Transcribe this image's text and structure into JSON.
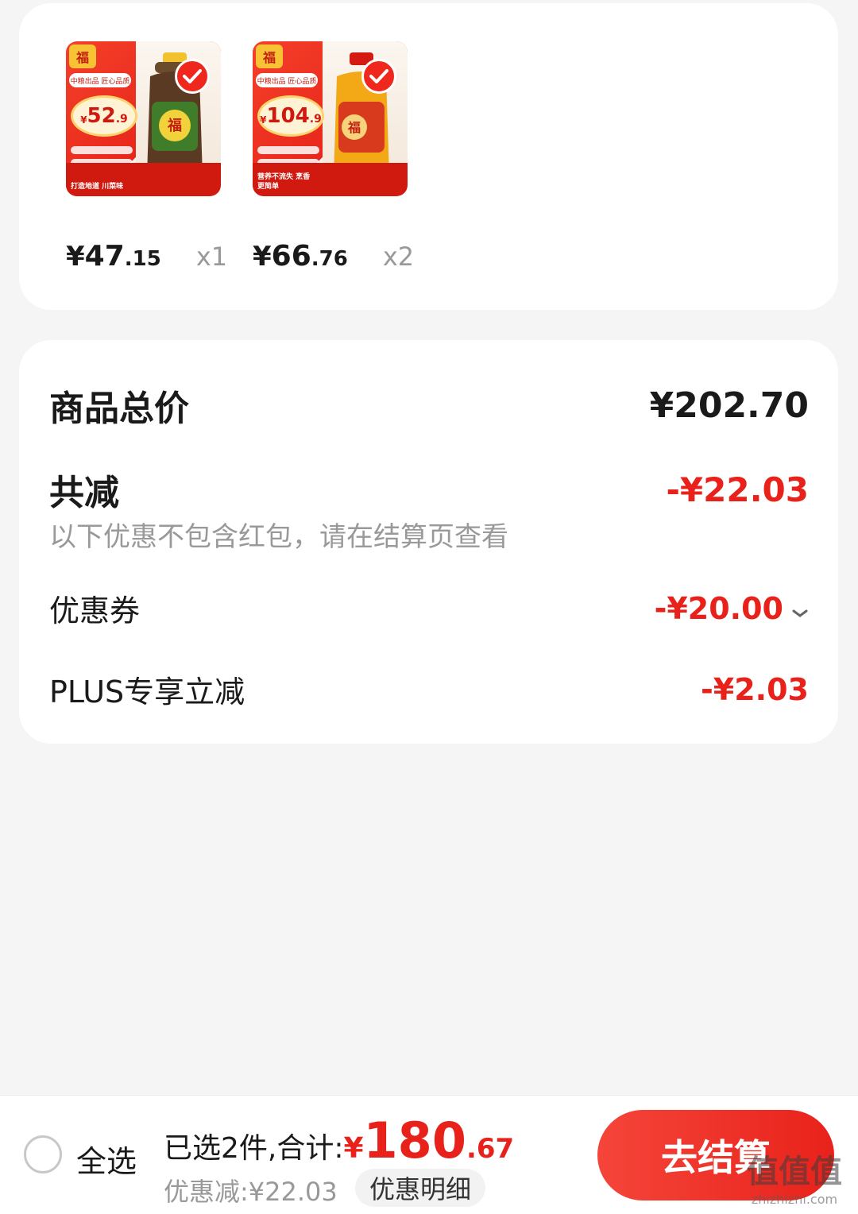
{
  "products": [
    {
      "thumb": {
        "brand": "福",
        "promo": "中粮出品 匠心品质",
        "price_yen": "¥",
        "price_int": "52",
        "price_dec": ".9",
        "slogan": "打造地道 川菜味"
      },
      "price_yen": "¥",
      "price_int": "47",
      "price_dec": ".15",
      "qty": "x1",
      "bottle_color": "#3f7d2b"
    },
    {
      "thumb": {
        "brand": "福",
        "promo": "中粮出品 匠心品质",
        "price_yen": "¥",
        "price_int": "104",
        "price_dec": ".9",
        "slogan": "营养不流失 烹香更简单"
      },
      "price_yen": "¥",
      "price_int": "66",
      "price_dec": ".76",
      "qty": "x2",
      "bottle_color": "#f2a915"
    }
  ],
  "summary": {
    "total_label": "商品总价",
    "total_value": "¥202.70",
    "reduce_label": "共减",
    "reduce_value": "-¥22.03",
    "note": "以下优惠不包含红包，请在结算页查看",
    "coupon_label": "优惠券",
    "coupon_value": "-¥20.00",
    "plus_label": "PLUS专享立减",
    "plus_value": "-¥2.03"
  },
  "bottom_bar": {
    "select_all": "全选",
    "selected_text": "已选2件,合计:",
    "total_yen": "¥",
    "total_int": "180",
    "total_dec": ".67",
    "discount_text": "优惠减:¥22.03",
    "detail_label": "优惠明细",
    "checkout_label": "去结算"
  },
  "watermark": {
    "logo": "值值值",
    "site": "zhizhizhi.com"
  },
  "colors": {
    "accent": "#e8221b",
    "muted": "#999999",
    "background": "#f5f5f5"
  }
}
